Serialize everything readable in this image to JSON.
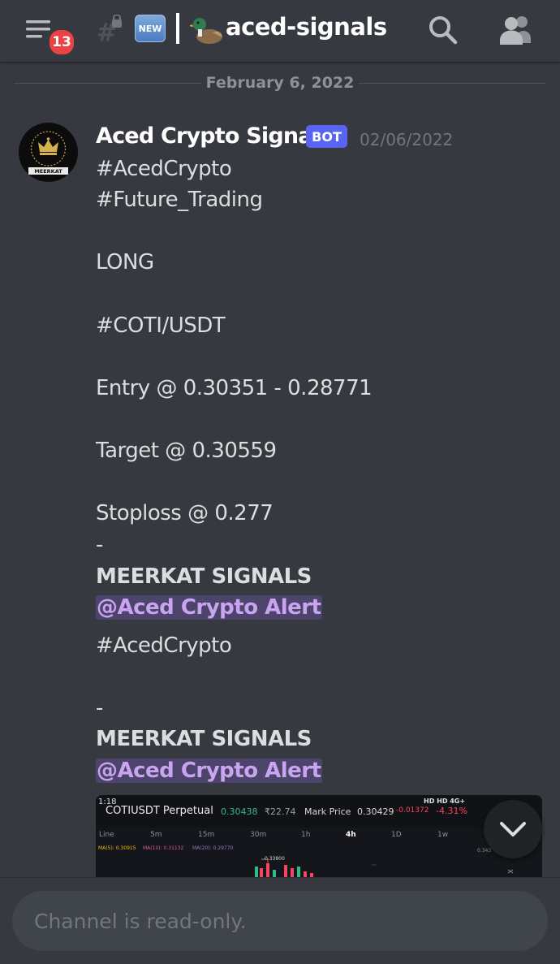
{
  "header": {
    "unread_count": "13",
    "new_label": "NEW",
    "channel_name": "aced-signals"
  },
  "date_divider": "February 6, 2022",
  "message": {
    "author": "Aced Crypto Signals",
    "bot_tag": "BOT",
    "timestamp": "02/06/2022",
    "avatar_text": "MEERKAT",
    "lines": {
      "tag1": "#AcedCrypto",
      "tag2": "#Future_Trading",
      "direction": "LONG",
      "pair": "#COTI/USDT",
      "entry": "Entry @ 0.30351 - 0.28771",
      "target": "Target @ 0.30559",
      "stoploss": "Stoploss @ 0.277",
      "dash1": "-",
      "signature1": "MEERKAT SIGNALS",
      "mention1": "@Aced Crypto Alert",
      "tag3": "#AcedCrypto",
      "dash2": "-",
      "signature2": "MEERKAT SIGNALS",
      "mention2": "@Aced Crypto Alert"
    },
    "attachment": {
      "status_time": "1:18",
      "status_right": "HD HD 4G+",
      "pair": "COTIUSDT Perpetual",
      "price": "0.30438",
      "inr": "₹22.74",
      "mark_label": "Mark Price",
      "mark_price": "0.30429",
      "change": "-0.01372",
      "change_pct": "-4.31%",
      "intervals": [
        "Line",
        "5m",
        "15m",
        "30m",
        "1h",
        "4h",
        "1D",
        "1w"
      ],
      "ma5": "MA(5): 0.30915",
      "ma10": "MA(10): 0.31132",
      "ma20": "MA(20): 0.29770",
      "peak": "0.33800",
      "right_tick": "0.343"
    }
  },
  "composer": {
    "placeholder": "Channel is read-only."
  },
  "colors": {
    "background": "#36393f",
    "bot_tag": "#5865f2",
    "badge": "#ed4245",
    "mention": "#c9a4f0"
  }
}
